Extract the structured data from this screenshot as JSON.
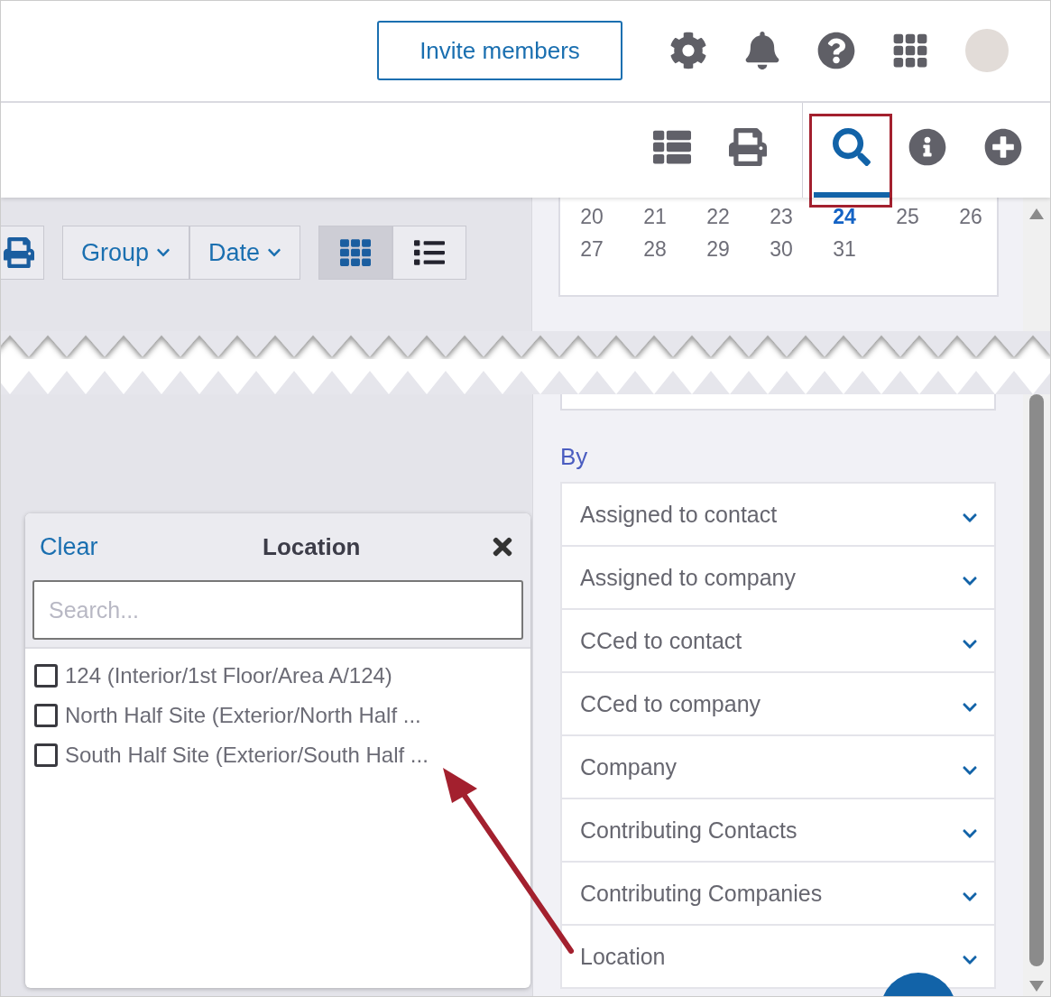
{
  "header": {
    "invite_button": "Invite members"
  },
  "view_tabs": [
    {
      "kind": "list",
      "selected": false
    },
    {
      "kind": "print",
      "selected": false
    },
    {
      "kind": "search",
      "selected": true
    },
    {
      "kind": "info",
      "selected": false
    },
    {
      "kind": "add",
      "selected": false
    }
  ],
  "calendar": {
    "weeks": [
      [
        {
          "day": "20",
          "selected": false
        },
        {
          "day": "21",
          "selected": false
        },
        {
          "day": "22",
          "selected": false
        },
        {
          "day": "23",
          "selected": false
        },
        {
          "day": "24",
          "selected": true
        },
        {
          "day": "25",
          "selected": false
        },
        {
          "day": "26",
          "selected": false
        }
      ],
      [
        {
          "day": "27",
          "selected": false
        },
        {
          "day": "28",
          "selected": false
        },
        {
          "day": "29",
          "selected": false
        },
        {
          "day": "30",
          "selected": false
        },
        {
          "day": "31",
          "selected": false
        }
      ]
    ]
  },
  "filter_toolbar": {
    "menus": [
      "Group",
      "Date"
    ],
    "views": [
      {
        "kind": "grid",
        "selected": true
      },
      {
        "kind": "list",
        "selected": false
      }
    ]
  },
  "location_popover": {
    "clear": "Clear",
    "title": "Location",
    "search": {
      "placeholder": "Search..."
    },
    "options": [
      {
        "label": "124 (Interior/1st Floor/Area A/124)",
        "checked": false
      },
      {
        "label": "North Half Site (Exterior/North Half ...",
        "checked": false
      },
      {
        "label": "South Half Site (Exterior/South Half ...",
        "checked": false
      }
    ]
  },
  "filters": {
    "heading": "By",
    "items": [
      "Assigned to contact",
      "Assigned to company",
      "CCed to contact",
      "CCed to company",
      "Company",
      "Contributing Contacts",
      "Contributing Companies",
      "Location"
    ]
  }
}
